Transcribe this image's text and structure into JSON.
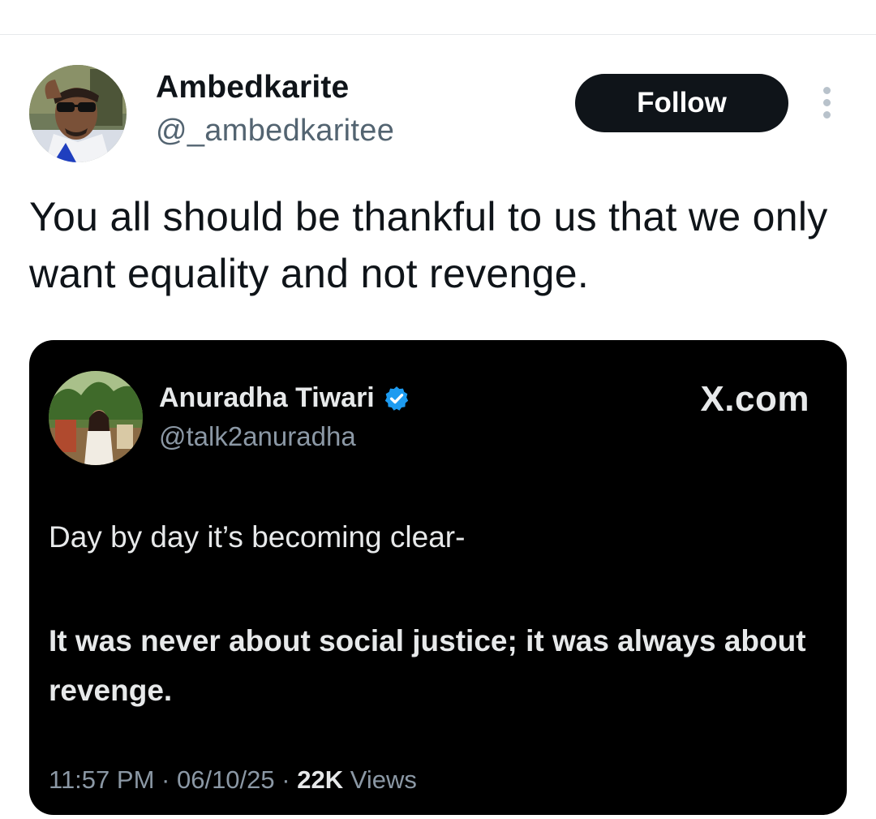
{
  "tweet": {
    "author_name": "Ambedkarite",
    "author_handle": "@_ambedkaritee",
    "follow_label": "Follow",
    "text": "You all should be thankful to us that we only want equality and not revenge."
  },
  "quoted": {
    "author_name": "Anuradha Tiwari",
    "author_handle": "@talk2anuradha",
    "site": "X.com",
    "line1": "Day by day it’s becoming clear-",
    "line2": "It was never about social justice; it was always about revenge.",
    "time": "11:57 PM",
    "date": "06/10/25",
    "separator": "·",
    "views_count": "22K",
    "views_label": "Views"
  },
  "icons": {
    "more": "more-vertical-icon",
    "verified": "verified-badge-icon"
  },
  "colors": {
    "follow_bg": "#0f1419",
    "handle": "#536471",
    "verified": "#1d9bf0",
    "quote_bg": "#000000"
  }
}
